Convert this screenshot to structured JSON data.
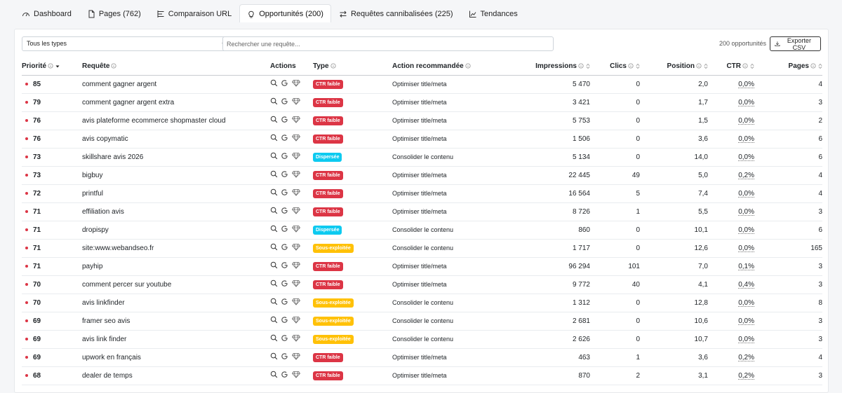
{
  "tabs": [
    {
      "label": "Dashboard",
      "icon": "gauge-icon",
      "active": false
    },
    {
      "label": "Pages (762)",
      "icon": "page-icon",
      "active": false
    },
    {
      "label": "Comparaison URL",
      "icon": "compare-list-icon",
      "active": false
    },
    {
      "label": "Opportunités (200)",
      "icon": "lightbulb-icon",
      "active": true
    },
    {
      "label": "Requêtes cannibalisées (225)",
      "icon": "swap-arrows-icon",
      "active": false
    },
    {
      "label": "Tendances",
      "icon": "trend-chart-icon",
      "active": false
    }
  ],
  "toolbar": {
    "type_filter": "Tous les types",
    "search_placeholder": "Rechercher une requête...",
    "count": "200 opportunités",
    "export_label": "Exporter CSV"
  },
  "columns": {
    "priorite": "Priorité",
    "requete": "Requête",
    "actions": "Actions",
    "type": "Type",
    "action": "Action recommandée",
    "impressions": "Impressions",
    "clics": "Clics",
    "position": "Position",
    "ctr": "CTR",
    "pages": "Pages"
  },
  "colors": {
    "ctr_faible": "#dc3545",
    "dispersee": "#0dcaf0",
    "sous_exploitee": "#ffc107",
    "priority_dot": "#dc3545"
  },
  "rows": [
    {
      "priorite": "85",
      "requete": "comment gagner argent",
      "type": "CTR faible",
      "type_key": "ctr",
      "action": "Optimiser title/meta",
      "impressions": "5 470",
      "clics": "0",
      "position": "2,0",
      "ctr": "0,0%",
      "pages": "4"
    },
    {
      "priorite": "79",
      "requete": "comment gagner argent extra",
      "type": "CTR faible",
      "type_key": "ctr",
      "action": "Optimiser title/meta",
      "impressions": "3 421",
      "clics": "0",
      "position": "1,7",
      "ctr": "0,0%",
      "pages": "3"
    },
    {
      "priorite": "76",
      "requete": "avis plateforme ecommerce shopmaster cloud",
      "type": "CTR faible",
      "type_key": "ctr",
      "action": "Optimiser title/meta",
      "impressions": "5 753",
      "clics": "0",
      "position": "1,5",
      "ctr": "0,0%",
      "pages": "2"
    },
    {
      "priorite": "76",
      "requete": "avis copymatic",
      "type": "CTR faible",
      "type_key": "ctr",
      "action": "Optimiser title/meta",
      "impressions": "1 506",
      "clics": "0",
      "position": "3,6",
      "ctr": "0,0%",
      "pages": "6"
    },
    {
      "priorite": "73",
      "requete": "skillshare avis 2026",
      "type": "Dispersée",
      "type_key": "disp",
      "action": "Consolider le contenu",
      "impressions": "5 134",
      "clics": "0",
      "position": "14,0",
      "ctr": "0,0%",
      "pages": "6"
    },
    {
      "priorite": "73",
      "requete": "bigbuy",
      "type": "CTR faible",
      "type_key": "ctr",
      "action": "Optimiser title/meta",
      "impressions": "22 445",
      "clics": "49",
      "position": "5,0",
      "ctr": "0,2%",
      "pages": "4"
    },
    {
      "priorite": "72",
      "requete": "printful",
      "type": "CTR faible",
      "type_key": "ctr",
      "action": "Optimiser title/meta",
      "impressions": "16 564",
      "clics": "5",
      "position": "7,4",
      "ctr": "0,0%",
      "pages": "4"
    },
    {
      "priorite": "71",
      "requete": "effiliation avis",
      "type": "CTR faible",
      "type_key": "ctr",
      "action": "Optimiser title/meta",
      "impressions": "8 726",
      "clics": "1",
      "position": "5,5",
      "ctr": "0,0%",
      "pages": "3"
    },
    {
      "priorite": "71",
      "requete": "dropispy",
      "type": "Dispersée",
      "type_key": "disp",
      "action": "Consolider le contenu",
      "impressions": "860",
      "clics": "0",
      "position": "10,1",
      "ctr": "0,0%",
      "pages": "6"
    },
    {
      "priorite": "71",
      "requete": "site:www.webandseo.fr",
      "type": "Sous-exploitée",
      "type_key": "sous",
      "action": "Consolider le contenu",
      "impressions": "1 717",
      "clics": "0",
      "position": "12,6",
      "ctr": "0,0%",
      "pages": "165"
    },
    {
      "priorite": "71",
      "requete": "payhip",
      "type": "CTR faible",
      "type_key": "ctr",
      "action": "Optimiser title/meta",
      "impressions": "96 294",
      "clics": "101",
      "position": "7,0",
      "ctr": "0,1%",
      "pages": "3"
    },
    {
      "priorite": "70",
      "requete": "comment percer sur youtube",
      "type": "CTR faible",
      "type_key": "ctr",
      "action": "Optimiser title/meta",
      "impressions": "9 772",
      "clics": "40",
      "position": "4,1",
      "ctr": "0,4%",
      "pages": "3"
    },
    {
      "priorite": "70",
      "requete": "avis linkfinder",
      "type": "Sous-exploitée",
      "type_key": "sous",
      "action": "Consolider le contenu",
      "impressions": "1 312",
      "clics": "0",
      "position": "12,8",
      "ctr": "0,0%",
      "pages": "8"
    },
    {
      "priorite": "69",
      "requete": "framer seo avis",
      "type": "Sous-exploitée",
      "type_key": "sous",
      "action": "Consolider le contenu",
      "impressions": "2 681",
      "clics": "0",
      "position": "10,6",
      "ctr": "0,0%",
      "pages": "3"
    },
    {
      "priorite": "69",
      "requete": "avis link finder",
      "type": "Sous-exploitée",
      "type_key": "sous",
      "action": "Consolider le contenu",
      "impressions": "2 626",
      "clics": "0",
      "position": "10,7",
      "ctr": "0,0%",
      "pages": "3"
    },
    {
      "priorite": "69",
      "requete": "upwork en français",
      "type": "CTR faible",
      "type_key": "ctr",
      "action": "Optimiser title/meta",
      "impressions": "463",
      "clics": "1",
      "position": "3,6",
      "ctr": "0,2%",
      "pages": "4"
    },
    {
      "priorite": "68",
      "requete": "dealer de temps",
      "type": "CTR faible",
      "type_key": "ctr",
      "action": "Optimiser title/meta",
      "impressions": "870",
      "clics": "2",
      "position": "3,1",
      "ctr": "0,2%",
      "pages": "3"
    }
  ]
}
